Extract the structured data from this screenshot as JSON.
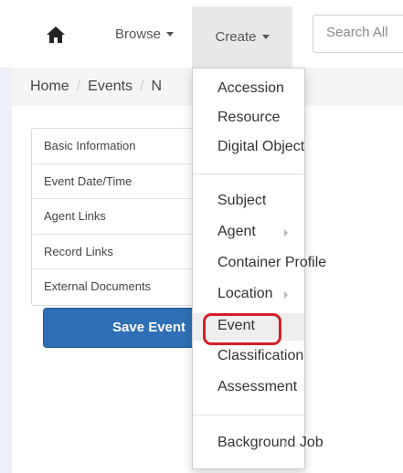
{
  "nav": {
    "browse_label": "Browse",
    "create_label": "Create",
    "search_placeholder": "Search All"
  },
  "breadcrumb": {
    "home": "Home",
    "events": "Events",
    "truncated": "N"
  },
  "sidebar": {
    "items": [
      "Basic Information",
      "Event Date/Time",
      "Agent Links",
      "Record Links",
      "External Documents"
    ],
    "save_label": "Save Event"
  },
  "create_menu": {
    "group1": [
      "Accession",
      "Resource",
      "Digital Object"
    ],
    "group2": [
      "Subject",
      "Agent",
      "Container Profile",
      "Location",
      "Event",
      "Classification",
      "Assessment"
    ],
    "group3": [
      "Background Job"
    ],
    "highlighted": "Event"
  },
  "colors": {
    "primary_button": "#2f6fb5",
    "highlight_ring": "#d21f25"
  },
  "icons": {
    "home": "home-icon",
    "caret": "caret-down-icon",
    "submenu": "chevron-right-icon"
  }
}
